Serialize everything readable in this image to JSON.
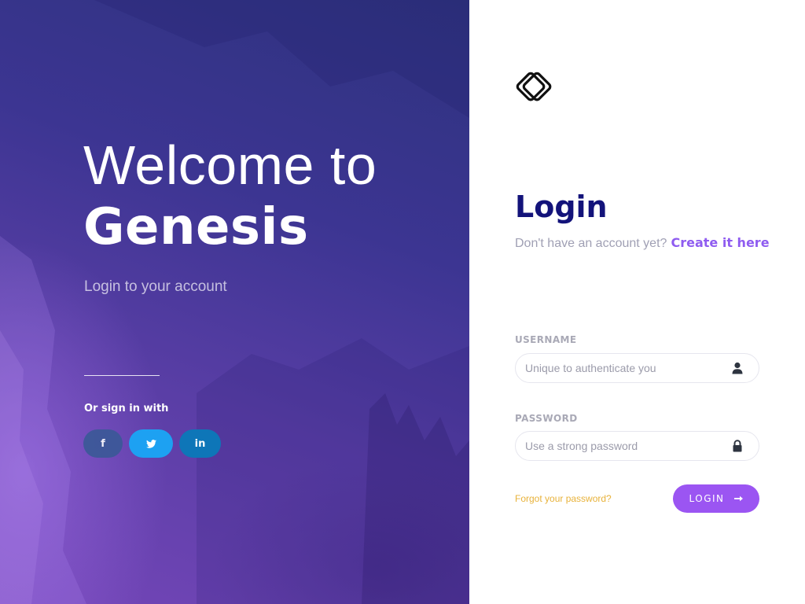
{
  "hero": {
    "welcome": "Welcome to",
    "brand": "Genesis",
    "tagline": "Login to your account",
    "social_label": "Or sign in with",
    "social": [
      {
        "name": "facebook",
        "label": "f",
        "color": "#3b5998"
      },
      {
        "name": "twitter",
        "label": "",
        "color": "#1da1f2"
      },
      {
        "name": "linkedin",
        "label": "in",
        "color": "#0e76b8"
      }
    ]
  },
  "login": {
    "logo_icon": "diamond-logo-icon",
    "title": "Login",
    "signup_prompt": "Don't have an account yet?",
    "signup_link": "Create it here",
    "username": {
      "label": "USERNAME",
      "placeholder": "Unique to authenticate you",
      "value": "",
      "icon": "user-icon"
    },
    "password": {
      "label": "PASSWORD",
      "placeholder": "Use a strong password",
      "value": "",
      "icon": "lock-icon"
    },
    "forgot_link": "Forgot your password?",
    "submit_label": "LOGIN",
    "submit_icon": "arrow-right-icon"
  },
  "colors": {
    "title": "#13137a",
    "accent": "#9b55f2",
    "link": "#8f5cf0",
    "forgot": "#e8b23a"
  }
}
